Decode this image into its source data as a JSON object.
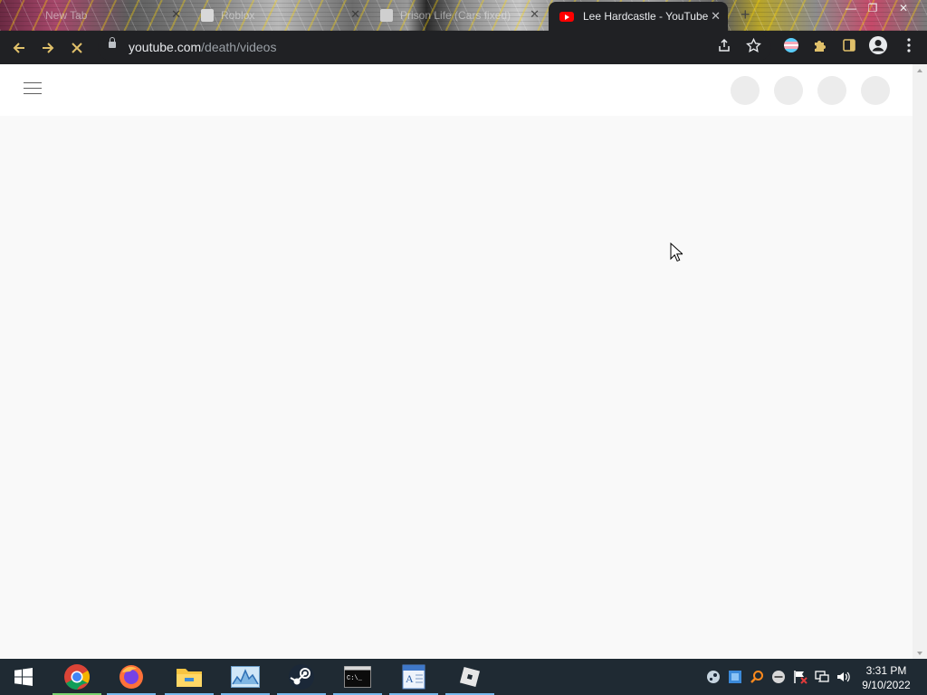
{
  "browser": {
    "tabs": [
      {
        "title": "New Tab",
        "active": false
      },
      {
        "title": "Roblox",
        "active": false
      },
      {
        "title": "Prison Life (Cars fixed)",
        "active": false
      },
      {
        "title": "Lee Hardcastle - YouTube",
        "active": true
      }
    ],
    "new_tab_icon": "+",
    "close_icon": "✕",
    "url": {
      "host": "youtube.com",
      "path": "/death/videos"
    },
    "colors": {
      "toolbar_bg": "#202124",
      "loading_accent": "#e0c06a",
      "youtube_red": "#ff0000"
    }
  },
  "page": {
    "masthead_icon": "hamburger-menu-icon",
    "skeleton_buttons": 4,
    "state": "loading"
  },
  "taskbar": {
    "apps": [
      {
        "name": "chrome-icon",
        "running": true,
        "active": true
      },
      {
        "name": "firefox-icon",
        "running": true
      },
      {
        "name": "file-explorer-icon",
        "running": true
      },
      {
        "name": "task-manager-icon",
        "running": true
      },
      {
        "name": "steam-icon",
        "running": true
      },
      {
        "name": "command-prompt-icon",
        "running": true
      },
      {
        "name": "wordpad-icon",
        "running": true
      },
      {
        "name": "roblox-icon",
        "running": true
      }
    ],
    "clock": {
      "time": "3:31 PM",
      "date": "9/10/2022"
    }
  }
}
